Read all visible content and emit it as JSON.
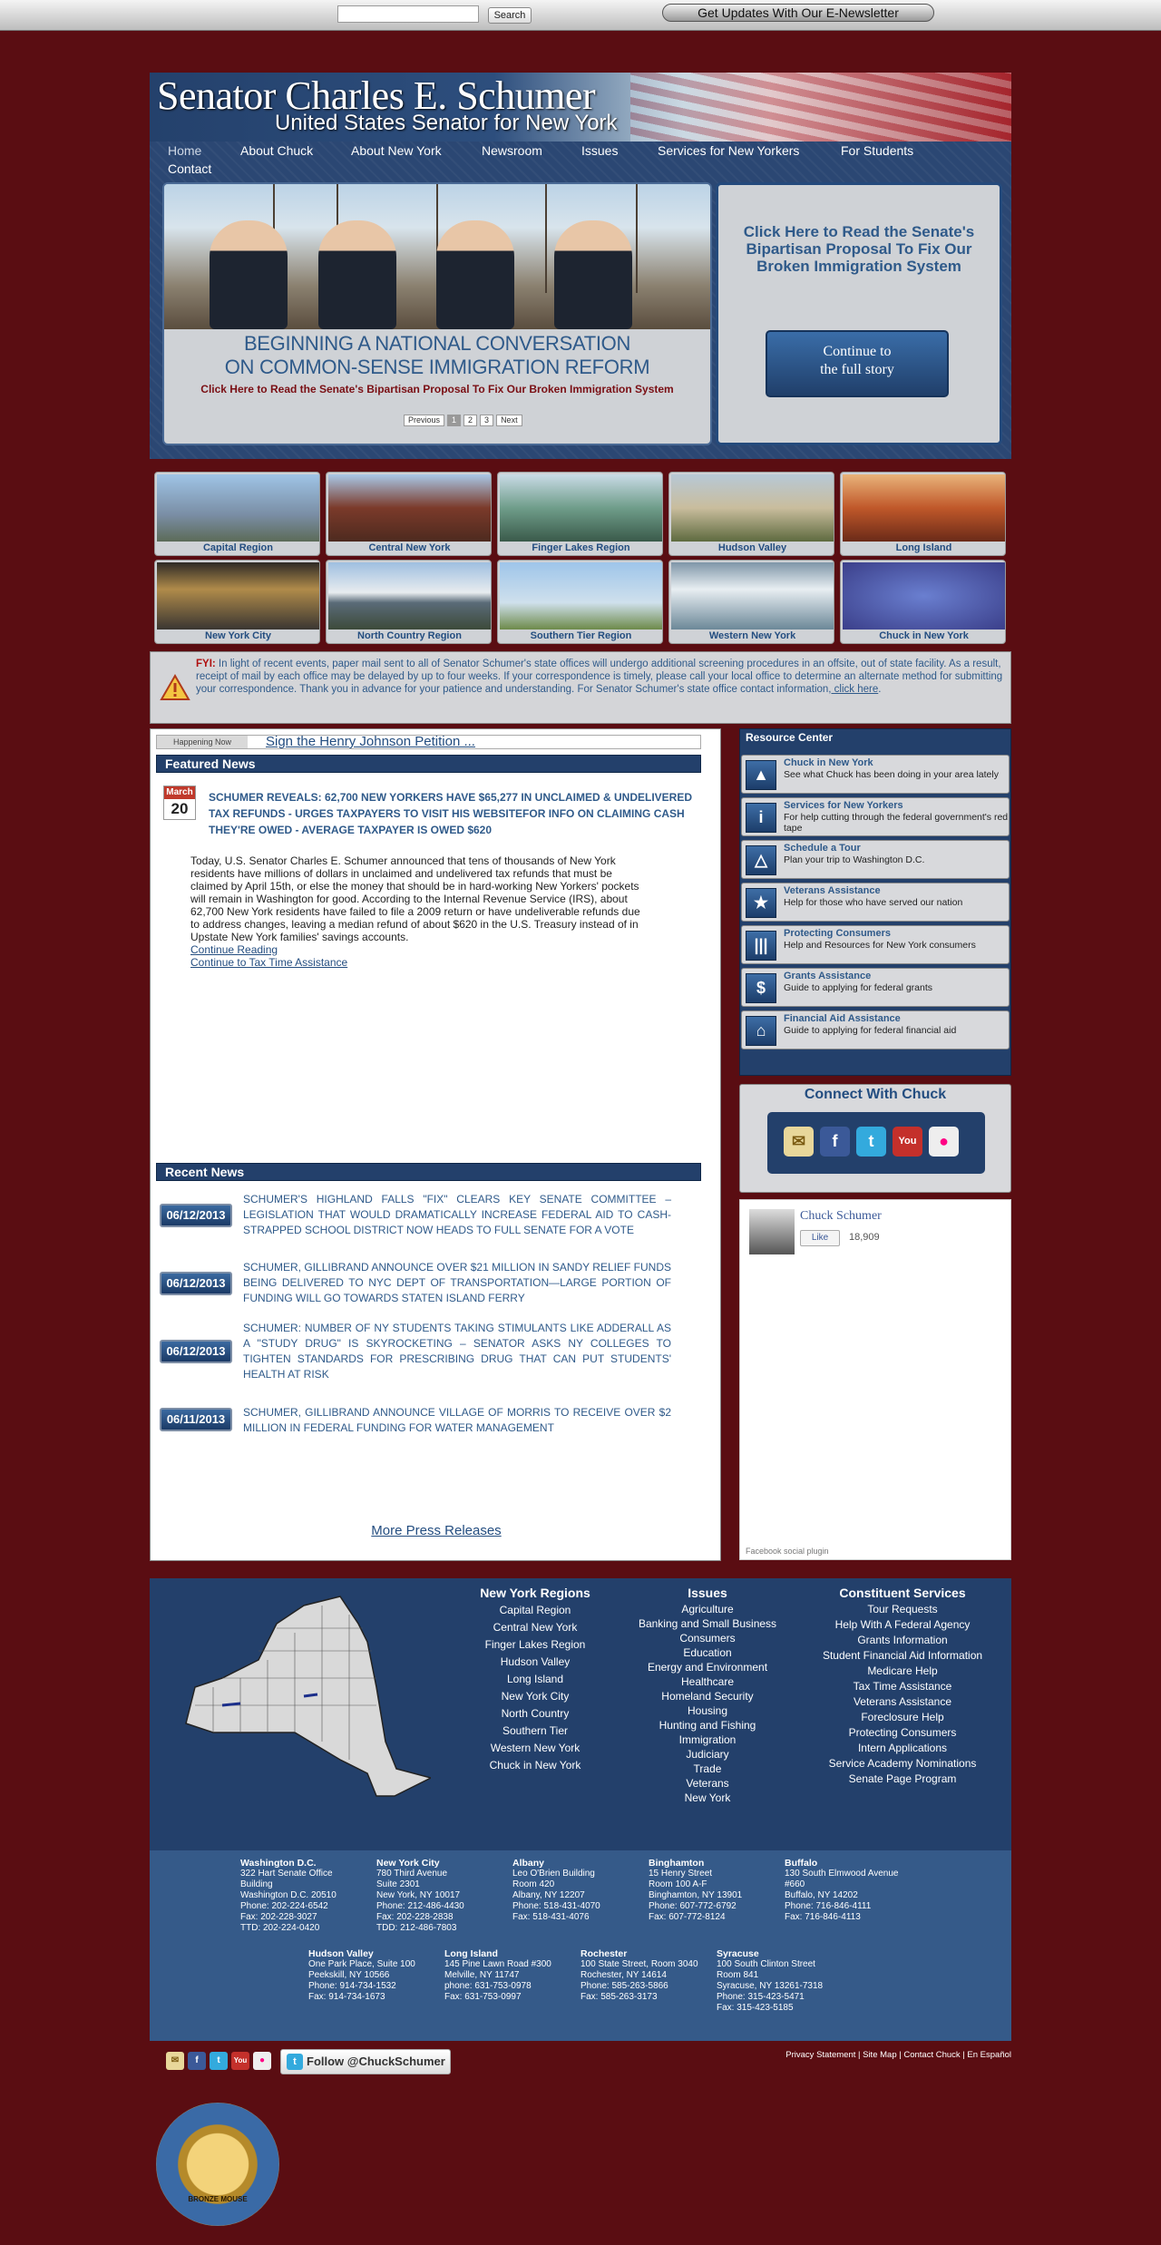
{
  "topbar": {
    "search_placeholder": "",
    "search_button": "Search",
    "enews_button": "Get Updates With Our E-Newsletter"
  },
  "header": {
    "title": "Senator Charles E. Schumer",
    "subtitle": "United States Senator for New York"
  },
  "nav": [
    "Home",
    "About Chuck",
    "About New York",
    "Newsroom",
    "Issues",
    "Services for New Yorkers",
    "For Students",
    "Contact"
  ],
  "slideshow": {
    "caption_line1": "BEGINNING A NATIONAL CONVERSATION",
    "caption_line2": "ON COMMON-SENSE IMMIGRATION REFORM",
    "subcaption": "Click Here to Read the Senate's Bipartisan Proposal To Fix Our Broken Immigration System",
    "pager": [
      "Previous",
      "1",
      "2",
      "3",
      "Next"
    ],
    "active_page": "1",
    "feature_text": "Click Here to Read the Senate's Bipartisan Proposal To Fix Our Broken Immigration System",
    "feature_button_line1": "Continue to",
    "feature_button_line2": "the full story"
  },
  "regions": [
    "Capital Region",
    "Central New York",
    "Finger Lakes Region",
    "Hudson Valley",
    "Long Island",
    "New York City",
    "North Country Region",
    "Southern Tier Region",
    "Western New York",
    "Chuck in New York"
  ],
  "fyi": {
    "label": "FYI:",
    "text": " In light of recent events, paper mail sent to all of Senator Schumer's state offices will undergo additional screening procedures in an offsite, out of state facility. As a result, receipt of mail by each office may be delayed by up to four weeks. If your correspondence is timely, please call your local office to determine an alternate method for submitting your correspondence. Thank you in advance for your patience and understanding. For Senator Schumer's state office contact information,",
    "link": " click here",
    "end": "."
  },
  "happening": {
    "label": "Happening Now",
    "link": "Sign the Henry Johnson Petition ..."
  },
  "featured": {
    "heading": "Featured News",
    "month": "March",
    "day": "20",
    "title": "SCHUMER REVEALS: 62,700 NEW YORKERS HAVE $65,277 IN UNCLAIMED & UNDELIVERED TAX REFUNDS - URGES TAXPAYERS TO VISIT HIS WEBSITEFOR INFO ON CLAIMING CASH THEY'RE OWED - AVERAGE TAXPAYER IS OWED $620",
    "body": "Today, U.S. Senator Charles E. Schumer announced that tens of thousands of New York residents have millions of dollars in unclaimed and undelivered tax refunds that must be claimed by April 15th, or else the money that should be in hard-working New Yorkers' pockets will remain in Washington for good. According to the Internal Revenue Service (IRS), about 62,700 New York residents have failed to file a 2009 return or have undeliverable refunds due to address changes, leaving a median refund of about $620 in the U.S. Treasury instead of in Upstate New York families' savings accounts.",
    "link1": "Continue Reading",
    "link2": "Continue to Tax Time Assistance"
  },
  "recent": {
    "heading": "Recent News",
    "items": [
      {
        "date": "06/12/2013",
        "text": "Schumer's Highland Falls \"FIX\" Clears Key Senate Committee – Legislation That Would Dramatically Increase Federal Aid To Cash-Strapped School District Now Heads To Full Senate For A Vote"
      },
      {
        "date": "06/12/2013",
        "text": "Schumer, Gillibrand Announce Over $21 Million In Sandy Relief Funds Being Delivered To NYC Dept Of Transportation—Large Portion Of Funding Will Go Towards Staten Island Ferry"
      },
      {
        "date": "06/12/2013",
        "text": "Schumer: Number Of NY Students Taking Stimulants Like Adderall As A \"Study Drug\" Is Skyrocketing – Senator Asks NY Colleges To Tighten Standards For Prescribing Drug That Can Put Students' Health At Risk"
      },
      {
        "date": "06/11/2013",
        "text": "Schumer, Gillibrand Announce Village Of Morris To Receive Over $2 Million In Federal Funding For Water Management"
      }
    ],
    "more": "More Press Releases"
  },
  "resource_center": {
    "title": "Resource Center",
    "items": [
      {
        "title": "Chuck in New York",
        "desc": "See what Chuck has been doing in your area lately",
        "icon": "ny-state-icon"
      },
      {
        "title": "Services for New Yorkers",
        "desc": "For help cutting through the federal government's red tape",
        "icon": "info-icon"
      },
      {
        "title": "Schedule a Tour",
        "desc": "Plan your trip to Washington D.C.",
        "icon": "capitol-icon"
      },
      {
        "title": "Veterans Assistance",
        "desc": "Help for those who have served our nation",
        "icon": "star-icon"
      },
      {
        "title": "Protecting Consumers",
        "desc": "Help and Resources for New York consumers",
        "icon": "columns-icon"
      },
      {
        "title": "Grants Assistance",
        "desc": "Guide to applying for federal grants",
        "icon": "dollar-icon"
      },
      {
        "title": "Financial Aid Assistance",
        "desc": "Guide to applying for federal financial aid",
        "icon": "school-icon"
      }
    ]
  },
  "connect": {
    "title": "Connect With Chuck"
  },
  "facebook": {
    "name": "Chuck Schumer",
    "like": "Like",
    "count": "18,909",
    "plugin": "Facebook social plugin"
  },
  "footer": {
    "regions": {
      "heading": "New York Regions",
      "items": [
        "Capital Region",
        "Central New York",
        "Finger Lakes Region",
        "Hudson Valley",
        "Long Island",
        "New York City",
        "North Country",
        "Southern Tier",
        "Western New York",
        "Chuck in New York"
      ]
    },
    "issues": {
      "heading": "Issues",
      "items": [
        "Agriculture",
        "Banking and Small Business",
        "Consumers",
        "Education",
        "Energy and Environment",
        "Healthcare",
        "Homeland Security",
        "Housing",
        "Hunting and Fishing",
        "Immigration",
        "Judiciary",
        "Trade",
        "Veterans",
        "New York"
      ]
    },
    "services": {
      "heading": "Constituent Services",
      "items": [
        "Tour Requests",
        "Help With A Federal Agency",
        "Grants Information",
        "Student Financial Aid Information",
        "Medicare Help",
        "Tax Time Assistance",
        "Veterans Assistance",
        "Foreclosure Help",
        "Protecting Consumers",
        "Intern Applications",
        "Service Academy Nominations",
        "Senate Page Program"
      ]
    },
    "offices": [
      {
        "name": "Washington D.C.",
        "lines": [
          "322 Hart Senate Office",
          "Building",
          "Washington D.C. 20510",
          "Phone: 202-224-6542",
          "Fax: 202-228-3027",
          "TTD: 202-224-0420"
        ]
      },
      {
        "name": "New York City",
        "lines": [
          "780 Third Avenue",
          "Suite 2301",
          "New York, NY 10017",
          "Phone: 212-486-4430",
          "Fax: 202-228-2838",
          "TDD: 212-486-7803"
        ]
      },
      {
        "name": "Albany",
        "lines": [
          "Leo O'Brien Building",
          "Room 420",
          "Albany, NY 12207",
          "Phone: 518-431-4070",
          "Fax: 518-431-4076"
        ]
      },
      {
        "name": "Binghamton",
        "lines": [
          "15 Henry Street",
          "Room 100 A-F",
          "Binghamton, NY 13901",
          "Phone: 607-772-6792",
          "Fax: 607-772-8124"
        ]
      },
      {
        "name": "Buffalo",
        "lines": [
          "130 South Elmwood Avenue",
          "#660",
          "Buffalo, NY 14202",
          "Phone: 716-846-4111",
          "Fax: 716-846-4113"
        ]
      },
      {
        "name": "Hudson Valley",
        "lines": [
          "One Park Place, Suite 100",
          "Peekskill, NY 10566",
          "Phone: 914-734-1532",
          "Fax: 914-734-1673"
        ]
      },
      {
        "name": "Long Island",
        "lines": [
          "145 Pine Lawn Road #300",
          "Melville, NY 11747",
          "phone: 631-753-0978",
          "Fax: 631-753-0997"
        ]
      },
      {
        "name": "Rochester",
        "lines": [
          "100 State Street, Room 3040",
          "Rochester, NY 14614",
          "Phone: 585-263-5866",
          "Fax: 585-263-3173"
        ]
      },
      {
        "name": "Syracuse",
        "lines": [
          "100 South Clinton Street",
          "Room 841",
          "Syracuse, NY 13261-7318",
          "Phone: 315-423-5471",
          "Fax: 315-423-5185"
        ]
      }
    ]
  },
  "bottom": {
    "follow": "Follow @ChuckSchumer",
    "links": "Privacy Statement | Site Map | Contact Chuck | En Español",
    "badge": "BRONZE MOUSE"
  },
  "colors": {
    "background": "#5a0d12",
    "navy": "#23406b",
    "link_blue": "#2f5a8a",
    "fyi_red": "#b01010"
  }
}
